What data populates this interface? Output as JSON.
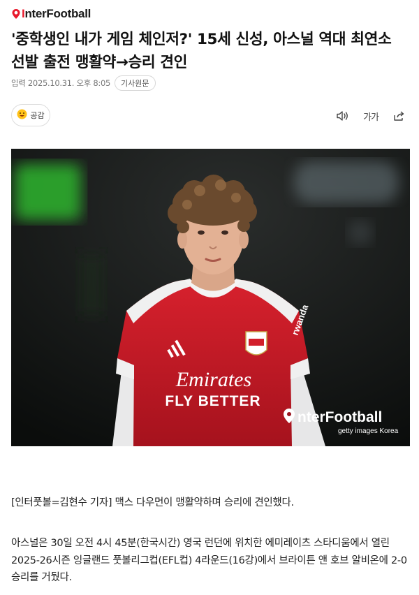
{
  "brand": {
    "name_prefix": "I",
    "name_main": "nterFootball",
    "accent": "#e8192c"
  },
  "article": {
    "headline": "'중학생인 내가 게임 체인저?' 15세 신성, 아스널 역대 최연소 선발 출전 맹활약→승리 견인",
    "published": "입력 2025.10.31. 오후 8:05",
    "source_button": "기사원문",
    "reaction_label": "공감",
    "font_size_icon_text": "가가",
    "photo": {
      "jersey_sponsor_line1": "Emirates",
      "jersey_sponsor_line2": "FLY BETTER",
      "jersey_club_badge": "Arsenal",
      "jersey_sleeve_text": "rwanda",
      "watermark_brand": "InterFootball",
      "watermark_credit": "getty images Korea",
      "jersey_color": "#d21f2b"
    },
    "paragraphs": [
      "[인터풋볼=김현수 기자] 맥스 다우먼이 맹활약하며 승리에 견인했다.",
      "아스널은 30일 오전 4시 45분(한국시간) 영국 런던에 위치한 에미레이츠 스타디움에서 열린 2025-26시즌 잉글랜드 풋볼리그컵(EFL컵) 4라운드(16강)에서 브라이튼 앤 호브 알비온에 2-0 승리를 거뒀다."
    ]
  },
  "icons": [
    "logo-pin-icon",
    "smile-emoji-icon",
    "speaker-icon",
    "font-size-icon",
    "share-icon"
  ]
}
